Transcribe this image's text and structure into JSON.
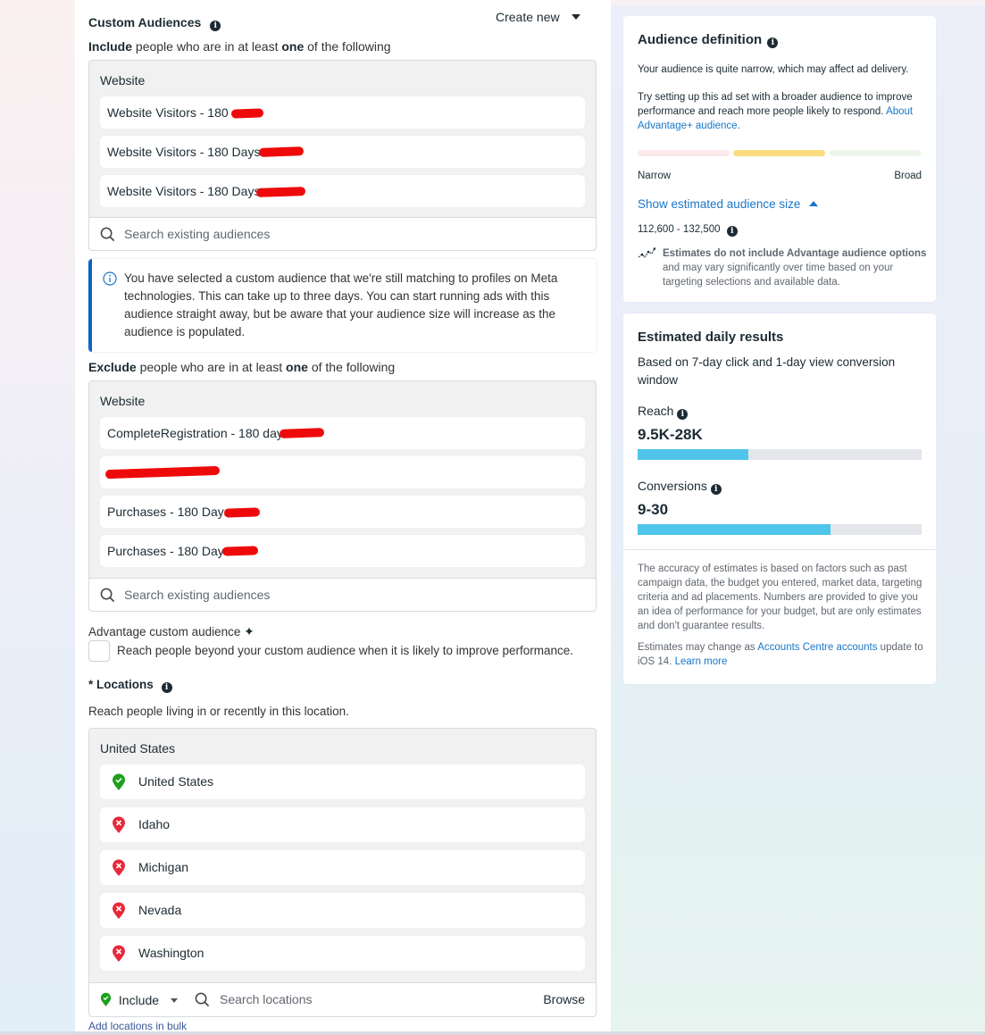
{
  "custom_audiences": {
    "title": "Custom Audiences",
    "create_new_label": "Create new",
    "include_prefix": "Include",
    "include_mid": " people who are in at least ",
    "include_bold": "one",
    "include_suffix": " of the following",
    "include_group": {
      "category": "Website",
      "items": [
        {
          "label": "Website Visitors - 180",
          "redacted": true
        },
        {
          "label": "Website Visitors - 180 Days",
          "redacted": true
        },
        {
          "label": "Website Visitors - 180 Days",
          "redacted": true
        }
      ],
      "search_placeholder": "Search existing audiences"
    },
    "notice": "You have selected a custom audience that we're still matching to profiles on Meta technologies. This can take up to three days. You can start running ads with this audience straight away, but be aware that your audience size will increase as the audience is populated.",
    "exclude_prefix": "Exclude",
    "exclude_mid": " people who are in at least ",
    "exclude_bold": "one",
    "exclude_suffix": " of the following",
    "exclude_group": {
      "category": "Website",
      "items": [
        {
          "label": "CompleteRegistration - 180 days",
          "redacted": true
        },
        {
          "label": "",
          "redacted": true
        },
        {
          "label": "Purchases - 180 Days",
          "redacted": true
        },
        {
          "label": "Purchases - 180 Days",
          "redacted": true
        }
      ],
      "search_placeholder": "Search existing audiences"
    },
    "advantage_label": "Advantage custom audience",
    "advantage_checkbox_label": "Reach people beyond your custom audience when it is likely to improve performance.",
    "advantage_checked": false
  },
  "locations": {
    "title": "* Locations",
    "subtitle": "Reach people living in or recently in this location.",
    "group": "United States",
    "items": [
      {
        "label": "United States",
        "type": "include"
      },
      {
        "label": "Idaho",
        "type": "exclude"
      },
      {
        "label": "Michigan",
        "type": "exclude"
      },
      {
        "label": "Nevada",
        "type": "exclude"
      },
      {
        "label": "Washington",
        "type": "exclude"
      }
    ],
    "mode_label": "Include",
    "search_placeholder": "Search locations",
    "browse_label": "Browse",
    "bulk_link": "Add locations in bulk"
  },
  "audience_definition": {
    "title": "Audience definition",
    "narrow_msg": "Your audience is quite narrow, which may affect ad delivery.",
    "suggestion": "Try setting up this ad set with a broader audience to improve performance and reach more people likely to respond. ",
    "suggestion_link": "About Advantage+ audience.",
    "meter_level": "middle",
    "meter_colors": [
      "#fde8ea",
      "#fddc80",
      "#edf5ea"
    ],
    "narrow_label": "Narrow",
    "broad_label": "Broad",
    "show_size_label": "Show estimated audience size",
    "size_range": "112,600 - 132,500",
    "estimates_bold": "Estimates do not include Advantage audience options",
    "estimates_rest": " and may vary significantly over time based on your targeting selections and available data."
  },
  "estimated_results": {
    "title": "Estimated daily results",
    "subtitle": "Based on 7-day click and 1-day view conversion window",
    "reach_label": "Reach",
    "reach_value": "9.5K-28K",
    "reach_fill_pct": 39,
    "conversions_label": "Conversions",
    "conversions_value": "9-30",
    "conversions_fill_pct": 68,
    "accuracy_note": "The accuracy of estimates is based on factors such as past campaign data, the budget you entered, market data, targeting criteria and ad placements. Numbers are provided to give you an idea of performance for your budget, but are only estimates and don't guarantee results.",
    "ios_prefix": "Estimates may change as ",
    "ios_link": "Accounts Centre accounts",
    "ios_mid": " update to iOS 14. ",
    "learn_more": "Learn more"
  },
  "colors": {
    "accent_blue": "#1877c9",
    "notice_border": "#0a66c2",
    "include_green": "#1ea01e",
    "exclude_red": "#e8283a",
    "bar_fill": "#4fc5eb"
  }
}
